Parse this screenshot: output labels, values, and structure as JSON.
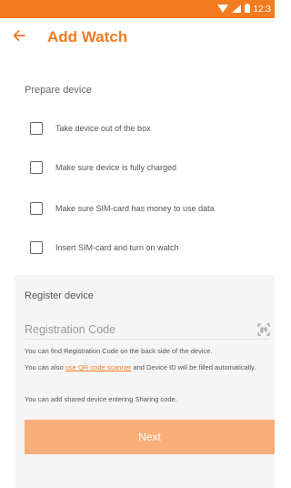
{
  "status_bar": {
    "time": "12:3",
    "color": "#f47b20",
    "icons": [
      "wifi-icon",
      "signal-icon",
      "battery-icon"
    ]
  },
  "header": {
    "title": "Add Watch",
    "back_icon": "back-arrow-icon",
    "accent_color": "#f47b20"
  },
  "prepare": {
    "title": "Prepare device",
    "items": [
      {
        "label": "Take device out of the box",
        "checked": false
      },
      {
        "label": "Make sure device is fully charged",
        "checked": false
      },
      {
        "label": "Make sure SIM-card has money to use data",
        "checked": false
      },
      {
        "label": "Insert SIM-card and turn on watch",
        "checked": false
      }
    ]
  },
  "register": {
    "title": "Register device",
    "field": {
      "placeholder": "Registration Code",
      "value": "",
      "icon": "qr-scan-icon"
    },
    "help_1": "You can find Registration Code on the back side of the device.",
    "help_2_prefix": "You can also ",
    "help_2_link": "use QR code scanner",
    "help_2_suffix": " and Device ID will be filled automatically.",
    "help_3": "You can add shared device entering Sharing code."
  },
  "actions": {
    "next_label": "Next",
    "next_color": "#f8ae78"
  }
}
